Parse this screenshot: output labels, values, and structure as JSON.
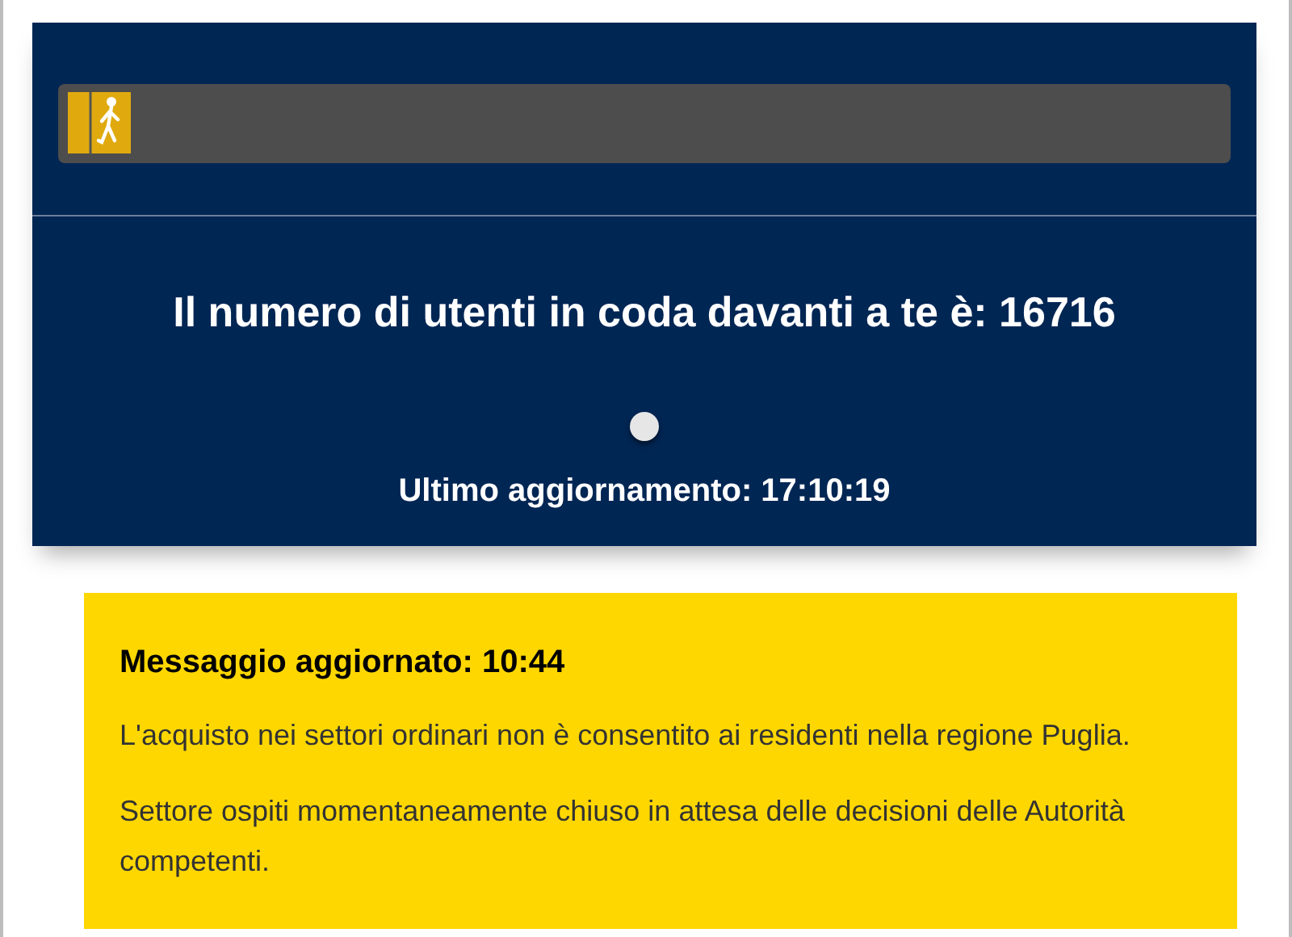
{
  "queue": {
    "progress": {
      "level": 0.05
    },
    "heading": "Il numero di utenti in coda davanti a te è: 16716",
    "last_update": "Ultimo aggiornamento: 17:10:19"
  },
  "notice": {
    "title": "Messaggio aggiornato: 10:44",
    "paragraphs": [
      "L'acquisto nei settori ordinari non è consentito ai residenti nella regione Puglia.",
      "Settore ospiti momentaneamente chiuso in attesa delle decisioni delle Autorità competenti."
    ]
  }
}
